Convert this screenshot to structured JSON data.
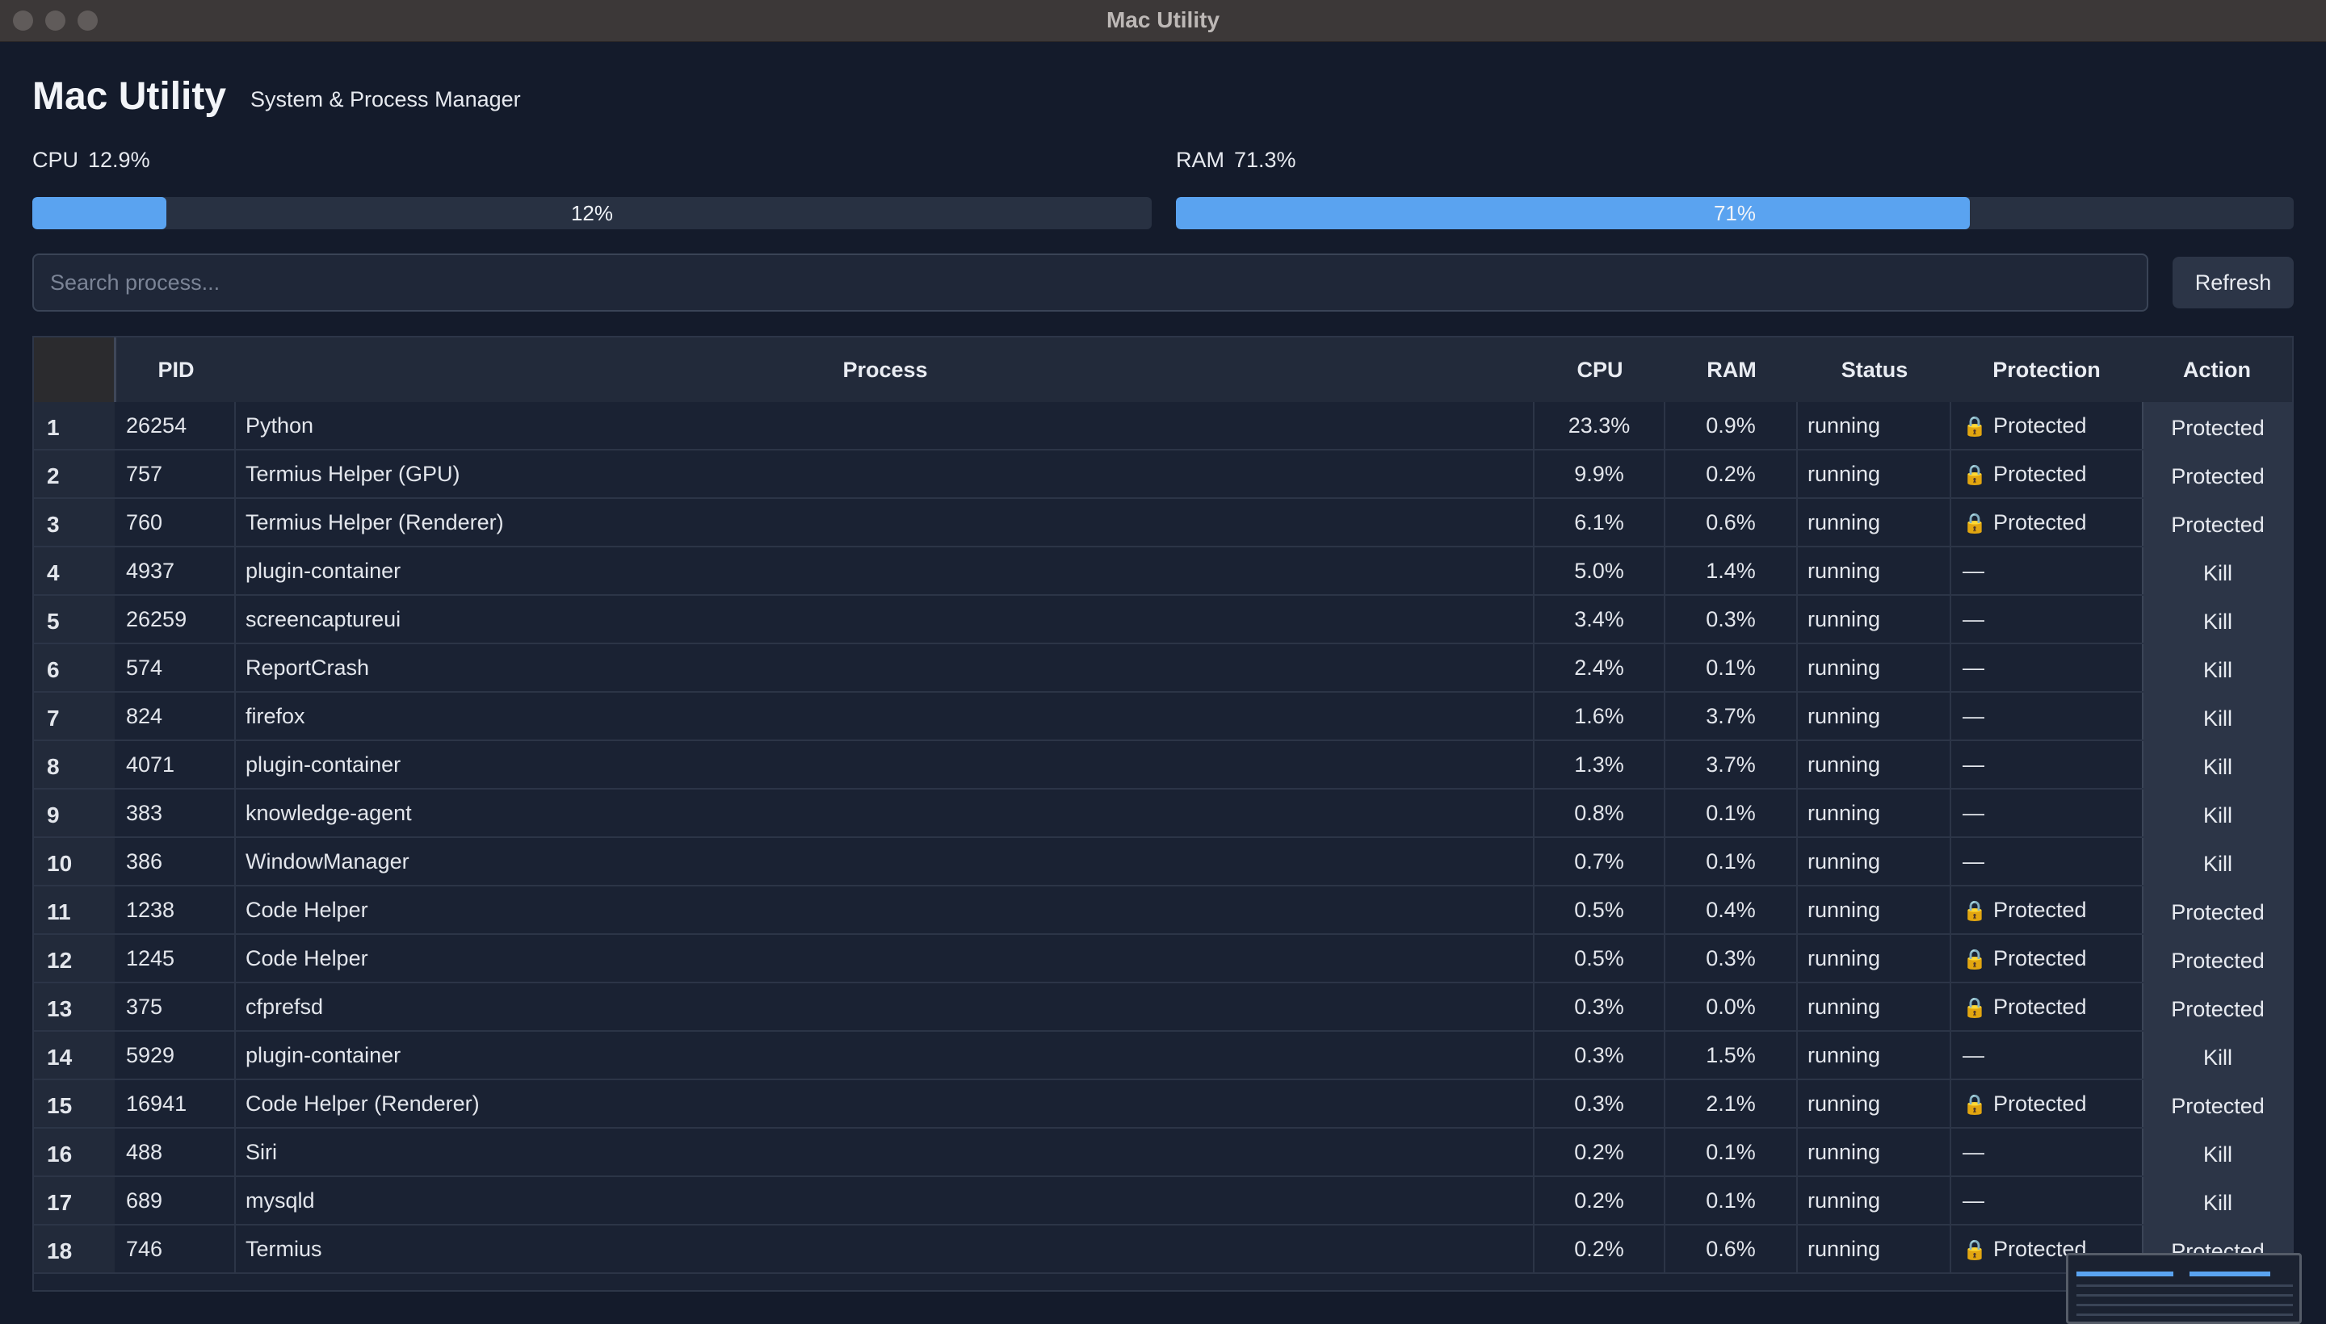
{
  "window": {
    "title": "Mac Utility"
  },
  "header": {
    "title": "Mac Utility",
    "subtitle": "System & Process Manager"
  },
  "metrics": {
    "cpu": {
      "label": "CPU",
      "value": "12.9%",
      "bar_text": "12%",
      "bar_fraction": 0.12
    },
    "ram": {
      "label": "RAM",
      "value": "71.3%",
      "bar_text": "71%",
      "bar_fraction": 0.71
    }
  },
  "search": {
    "placeholder": "Search process...",
    "value": ""
  },
  "refresh_label": "Refresh",
  "table": {
    "columns": [
      "PID",
      "Process",
      "CPU",
      "RAM",
      "Status",
      "Protection",
      "Action"
    ],
    "rows": [
      {
        "idx": "1",
        "pid": "26254",
        "process": "Python",
        "cpu": "23.3%",
        "ram": "0.9%",
        "status": "running",
        "protection": "Protected",
        "locked": true,
        "action": "Protected"
      },
      {
        "idx": "2",
        "pid": "757",
        "process": "Termius Helper (GPU)",
        "cpu": "9.9%",
        "ram": "0.2%",
        "status": "running",
        "protection": "Protected",
        "locked": true,
        "action": "Protected"
      },
      {
        "idx": "3",
        "pid": "760",
        "process": "Termius Helper (Renderer)",
        "cpu": "6.1%",
        "ram": "0.6%",
        "status": "running",
        "protection": "Protected",
        "locked": true,
        "action": "Protected"
      },
      {
        "idx": "4",
        "pid": "4937",
        "process": "plugin-container",
        "cpu": "5.0%",
        "ram": "1.4%",
        "status": "running",
        "protection": "—",
        "locked": false,
        "action": "Kill"
      },
      {
        "idx": "5",
        "pid": "26259",
        "process": "screencaptureui",
        "cpu": "3.4%",
        "ram": "0.3%",
        "status": "running",
        "protection": "—",
        "locked": false,
        "action": "Kill"
      },
      {
        "idx": "6",
        "pid": "574",
        "process": "ReportCrash",
        "cpu": "2.4%",
        "ram": "0.1%",
        "status": "running",
        "protection": "—",
        "locked": false,
        "action": "Kill"
      },
      {
        "idx": "7",
        "pid": "824",
        "process": "firefox",
        "cpu": "1.6%",
        "ram": "3.7%",
        "status": "running",
        "protection": "—",
        "locked": false,
        "action": "Kill"
      },
      {
        "idx": "8",
        "pid": "4071",
        "process": "plugin-container",
        "cpu": "1.3%",
        "ram": "3.7%",
        "status": "running",
        "protection": "—",
        "locked": false,
        "action": "Kill"
      },
      {
        "idx": "9",
        "pid": "383",
        "process": "knowledge-agent",
        "cpu": "0.8%",
        "ram": "0.1%",
        "status": "running",
        "protection": "—",
        "locked": false,
        "action": "Kill"
      },
      {
        "idx": "10",
        "pid": "386",
        "process": "WindowManager",
        "cpu": "0.7%",
        "ram": "0.1%",
        "status": "running",
        "protection": "—",
        "locked": false,
        "action": "Kill"
      },
      {
        "idx": "11",
        "pid": "1238",
        "process": "Code Helper",
        "cpu": "0.5%",
        "ram": "0.4%",
        "status": "running",
        "protection": "Protected",
        "locked": true,
        "action": "Protected"
      },
      {
        "idx": "12",
        "pid": "1245",
        "process": "Code Helper",
        "cpu": "0.5%",
        "ram": "0.3%",
        "status": "running",
        "protection": "Protected",
        "locked": true,
        "action": "Protected"
      },
      {
        "idx": "13",
        "pid": "375",
        "process": "cfprefsd",
        "cpu": "0.3%",
        "ram": "0.0%",
        "status": "running",
        "protection": "Protected",
        "locked": true,
        "action": "Protected"
      },
      {
        "idx": "14",
        "pid": "5929",
        "process": "plugin-container",
        "cpu": "0.3%",
        "ram": "1.5%",
        "status": "running",
        "protection": "—",
        "locked": false,
        "action": "Kill"
      },
      {
        "idx": "15",
        "pid": "16941",
        "process": "Code Helper (Renderer)",
        "cpu": "0.3%",
        "ram": "2.1%",
        "status": "running",
        "protection": "Protected",
        "locked": true,
        "action": "Protected"
      },
      {
        "idx": "16",
        "pid": "488",
        "process": "Siri",
        "cpu": "0.2%",
        "ram": "0.1%",
        "status": "running",
        "protection": "—",
        "locked": false,
        "action": "Kill"
      },
      {
        "idx": "17",
        "pid": "689",
        "process": "mysqld",
        "cpu": "0.2%",
        "ram": "0.1%",
        "status": "running",
        "protection": "—",
        "locked": false,
        "action": "Kill"
      },
      {
        "idx": "18",
        "pid": "746",
        "process": "Termius",
        "cpu": "0.2%",
        "ram": "0.6%",
        "status": "running",
        "protection": "Protected",
        "locked": true,
        "action": "Protected"
      }
    ]
  },
  "icons": {
    "lock": "lock-icon"
  },
  "colors": {
    "accent": "#5aa3f0",
    "background": "#141b2b"
  }
}
